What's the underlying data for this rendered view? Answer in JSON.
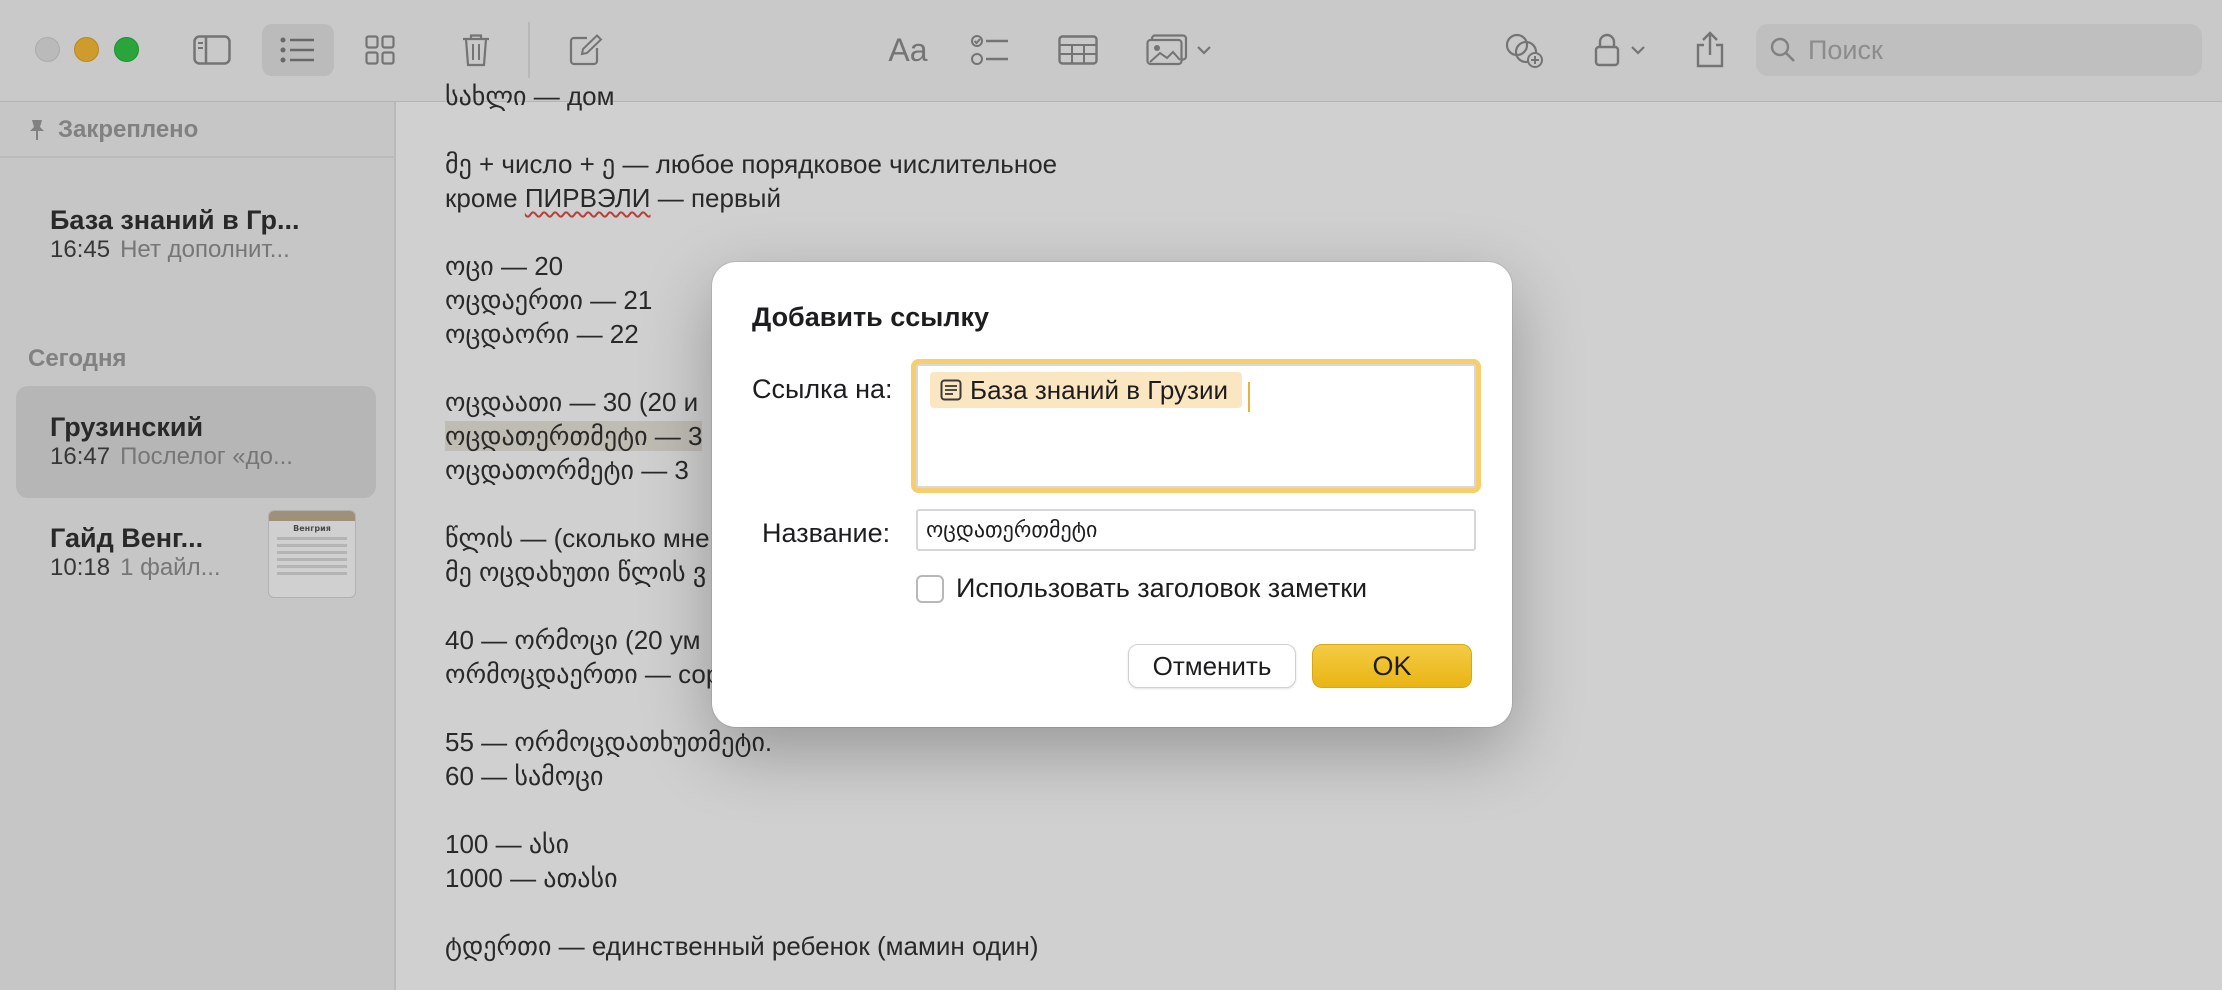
{
  "toolbar": {
    "search_placeholder": "Поиск",
    "buttons": [
      "sidebar-toggle",
      "list-view",
      "gallery-view",
      "delete",
      "compose",
      "format",
      "checklist",
      "table",
      "media",
      "collaborate",
      "lock",
      "share"
    ]
  },
  "sidebar": {
    "pinned_header": "Закреплено",
    "today_header": "Сегодня",
    "pinned_notes": [
      {
        "title": "База знаний в Гр...",
        "time": "16:45",
        "preview": "Нет дополнит..."
      }
    ],
    "today_notes": [
      {
        "title": "Грузинский",
        "time": "16:47",
        "preview": "Послелог «до...",
        "selected": true
      },
      {
        "title": "Гайд Венг...",
        "time": "10:18",
        "preview": "1 файл...",
        "thumbnail_title": "Венгрия"
      }
    ]
  },
  "editor": {
    "lines": [
      "სახლი — дом",
      "",
      "მე + число + ე — любое порядковое числительное",
      "кроме ПИРВЭЛИ — первый",
      "",
      "ოცი — 20",
      "ოცდაერთი — 21",
      "ოცდაორი — 22",
      "",
      "ოცდაათი — 30 (20 и",
      "ოცდათერთმეტი — 3",
      "ოცდათორმეტი — 3",
      "",
      "წლის — (сколько мне",
      "მე ოცდახუთი წლის ვ",
      "",
      "40 — ორმოცი (20 ум",
      "ორმოცდაერთი — сор",
      "",
      "55 — ორმოცდათხუთმეტი.",
      "60 — სამოცი",
      "",
      "100 — ასი",
      "1000 — ათასი",
      "",
      "ტდერთი — единственный ребенок (мамин один)"
    ],
    "misspelled_word": "ПИРВЭЛИ"
  },
  "dialog": {
    "title": "Добавить ссылку",
    "link_label": "Ссылка на:",
    "link_token": "База знаний в Грузии",
    "name_label": "Название:",
    "name_value": "ოცდათერთმეტი",
    "checkbox_label": "Использовать заголовок заметки",
    "checkbox_checked": false,
    "cancel_label": "Отменить",
    "ok_label": "OK",
    "accent_color": "#f0c02e"
  }
}
